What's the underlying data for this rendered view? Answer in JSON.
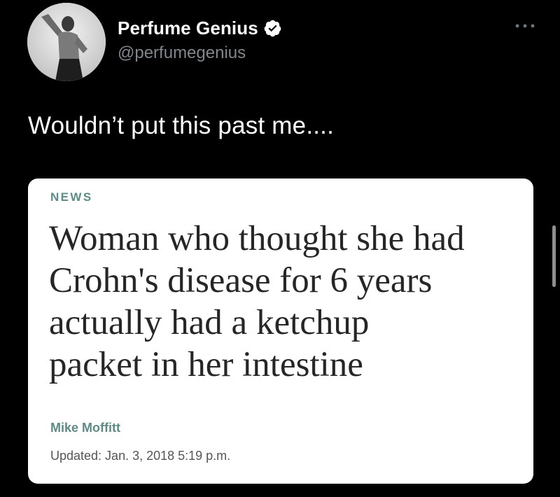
{
  "tweet": {
    "display_name": "Perfume Genius",
    "handle": "@perfumegenius",
    "verified": true,
    "text": "Wouldn’t put this past me....",
    "avatar": "profile-photo",
    "more_icon": "more-horizontal-icon"
  },
  "card": {
    "label": "NEWS",
    "headline_lines": [
      "Woman who thought she had",
      "Crohn's disease for 6 years",
      "actually had a ketchup",
      "packet in her intestine"
    ],
    "author": "Mike Moffitt",
    "updated": "Updated: Jan. 3, 2018 5:19 p.m."
  },
  "colors": {
    "background": "#000000",
    "verified_badge": "#ffffff",
    "handle_text": "#7f868c",
    "card_background": "#ffffff",
    "card_accent": "#5d8b87",
    "headline_text": "#262626"
  }
}
